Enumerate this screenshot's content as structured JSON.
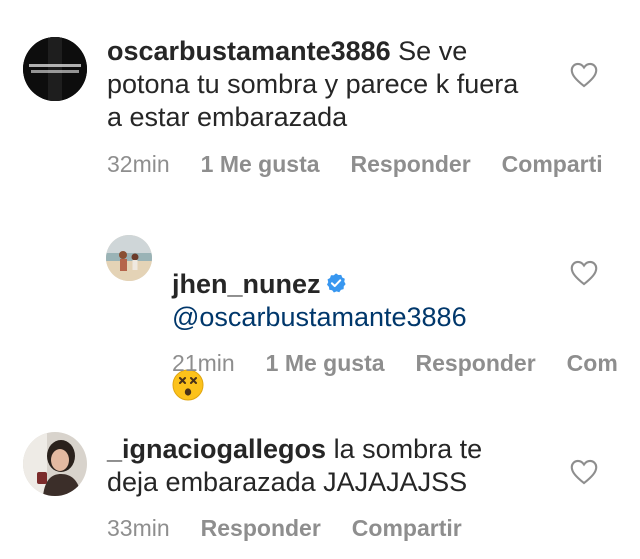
{
  "comments": [
    {
      "username": "oscarbustamante3886",
      "text": "Se ve potona tu sombra y parece k fuera a estar embarazada",
      "time": "32min",
      "likes": "1 Me gusta",
      "reply": "Responder",
      "share": "Comparti",
      "avatar_icon": "dark-avatar-icon"
    },
    {
      "username": "jhen_nunez",
      "verified": true,
      "mention": "@oscarbustamante3886",
      "emoji": "dizzy-face-emoji",
      "time": "21min",
      "likes": "1 Me gusta",
      "reply": "Responder",
      "share": "Com",
      "avatar_icon": "beach-photo-avatar-icon"
    },
    {
      "username": "_ignaciogallegos",
      "text": "la sombra te deja embarazada JAJAJAJSS",
      "time": "33min",
      "reply": "Responder",
      "share": "Compartir",
      "avatar_icon": "portrait-avatar-icon"
    }
  ],
  "colors": {
    "text": "#262626",
    "meta": "#8e8e8e",
    "mention": "#00376b",
    "verified": "#3897f0"
  }
}
